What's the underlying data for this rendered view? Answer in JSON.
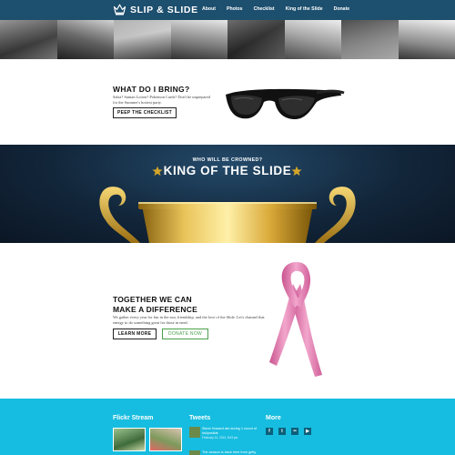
{
  "header": {
    "logo_text": "SLIP & SLIDE",
    "nav": [
      {
        "label": "About"
      },
      {
        "label": "Photos"
      },
      {
        "label": "Checklist"
      },
      {
        "label": "King of the Slide"
      },
      {
        "label": "Donate"
      }
    ]
  },
  "bring": {
    "title": "WHAT DO I BRING?",
    "text": "Salsa? Suntan Lotion? Pokemon Cards? Don't be unprepared for the Summer's hottest party.",
    "button": "PEEP THE CHECKLIST"
  },
  "king": {
    "subtitle": "WHO WILL BE CROWNED?",
    "title": "KING OF THE SLIDE"
  },
  "difference": {
    "title_line1": "TOGETHER WE CAN",
    "title_line2": "MAKE A DIFFERENCE",
    "text": "We gather every year for fun in the sun, friendship, and the love of the Slide. Let's channel that energy to do something great for those in need.",
    "learn_button": "LEARN MORE",
    "donate_button": "DONATE NOW"
  },
  "footer": {
    "flickr_heading": "Flickr Stream",
    "tweets_heading": "Tweets",
    "more_heading": "More",
    "tweets": [
      {
        "text": "Steve Howard ate during 1 round of #slipnslide",
        "date": "February 14, 2013, 8:03 pm"
      },
      {
        "text": "The season is back here from getty",
        "date": ""
      }
    ],
    "social_icons": [
      "facebook-icon",
      "twitter-icon",
      "flickr-icon",
      "youtube-icon"
    ]
  },
  "colors": {
    "navbar": "#1d4f6e",
    "footer": "#17bde0",
    "gold": "#d4a52a",
    "ribbon": "#e98bbd",
    "donate_green": "#4aa04a"
  }
}
